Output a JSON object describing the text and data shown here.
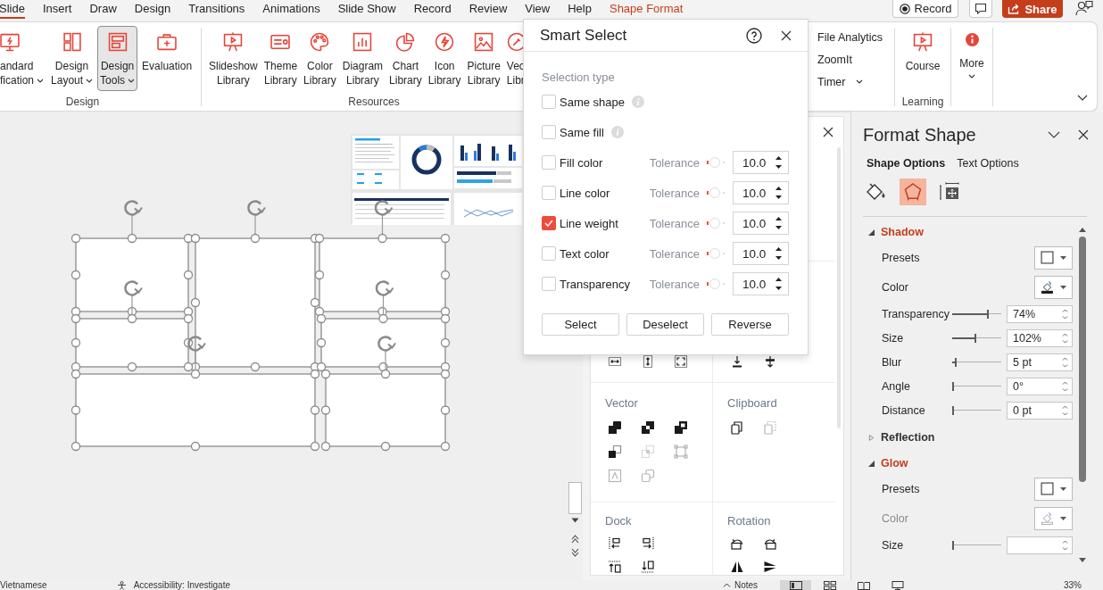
{
  "tabs": [
    {
      "label": "Slide",
      "selected": true,
      "contextual": false
    },
    {
      "label": "Insert",
      "selected": false,
      "contextual": false
    },
    {
      "label": "Draw",
      "selected": false,
      "contextual": false
    },
    {
      "label": "Design",
      "selected": false,
      "contextual": false
    },
    {
      "label": "Transitions",
      "selected": false,
      "contextual": false
    },
    {
      "label": "Animations",
      "selected": false,
      "contextual": false
    },
    {
      "label": "Slide Show",
      "selected": false,
      "contextual": false
    },
    {
      "label": "Record",
      "selected": false,
      "contextual": false
    },
    {
      "label": "Review",
      "selected": false,
      "contextual": false
    },
    {
      "label": "View",
      "selected": false,
      "contextual": false
    },
    {
      "label": "Help",
      "selected": false,
      "contextual": false
    },
    {
      "label": "Shape Format",
      "selected": false,
      "contextual": true
    }
  ],
  "title_actions": {
    "record": "Record",
    "share": "Share"
  },
  "ribbon": {
    "groups": [
      {
        "kind": "large",
        "label": "Design",
        "buttons": [
          {
            "kind": "monitor",
            "lines": [
              "andard",
              "fication"
            ],
            "dropdown": true,
            "pressed": false
          },
          {
            "kind": "layout",
            "lines": [
              "Design",
              "Layout"
            ],
            "dropdown": true,
            "pressed": false
          },
          {
            "kind": "tools",
            "lines": [
              "Design",
              "Tools"
            ],
            "dropdown": true,
            "pressed": true
          },
          {
            "kind": "kit",
            "lines": [
              "Evaluation"
            ],
            "dropdown": false,
            "pressed": false
          }
        ]
      },
      {
        "kind": "large",
        "label": "Resources",
        "buttons": [
          {
            "kind": "easel",
            "lines": [
              "Slideshow",
              "Library"
            ],
            "dropdown": false,
            "pressed": false
          },
          {
            "kind": "theme",
            "lines": [
              "Theme",
              "Library"
            ],
            "dropdown": false,
            "pressed": false
          },
          {
            "kind": "palette",
            "lines": [
              "Color",
              "Library"
            ],
            "dropdown": false,
            "pressed": false
          },
          {
            "kind": "diagram",
            "lines": [
              "Diagram",
              "Library"
            ],
            "dropdown": false,
            "pressed": false
          },
          {
            "kind": "pie",
            "lines": [
              "Chart",
              "Library"
            ],
            "dropdown": false,
            "pressed": false
          },
          {
            "kind": "bolt",
            "lines": [
              "Icon",
              "Library"
            ],
            "dropdown": false,
            "pressed": false
          },
          {
            "kind": "picture",
            "lines": [
              "Picture",
              "Library"
            ],
            "dropdown": false,
            "pressed": false
          },
          {
            "kind": "pen",
            "lines": [
              "Vec",
              "Libr"
            ],
            "dropdown": false,
            "pressed": false
          }
        ]
      },
      {
        "kind": "small",
        "buttons": [
          {
            "label": "File Analytics",
            "dropdown": false
          },
          {
            "label": "ZoomIt",
            "dropdown": false
          },
          {
            "label": "Timer",
            "dropdown": true
          }
        ]
      },
      {
        "kind": "large",
        "label": "Learning",
        "buttons": [
          {
            "kind": "easel",
            "lines": [
              "Course"
            ],
            "dropdown": false,
            "pressed": false
          }
        ]
      },
      {
        "kind": "large",
        "buttons": [
          {
            "kind": "info",
            "lines": [
              "More"
            ],
            "dropdown": true,
            "pressed": false
          }
        ]
      }
    ]
  },
  "canvas": {
    "shapes": [
      {
        "selected": true
      },
      {
        "selected": true
      },
      {
        "selected": true
      },
      {
        "selected": true
      },
      {
        "selected": true
      },
      {
        "selected": true
      },
      {
        "selected": true
      }
    ]
  },
  "tools_panel": {
    "sections": [
      {
        "columns": [
          {
            "rows": [
              [
                {
                  "kind": "same-width",
                  "disabled": false
                },
                {
                  "kind": "same-height",
                  "disabled": false
                },
                {
                  "kind": "same-size",
                  "disabled": false
                }
              ]
            ]
          },
          {
            "rows": [
              [
                {
                  "kind": "align-bottom",
                  "disabled": false
                },
                {
                  "kind": "distribute",
                  "disabled": false
                }
              ]
            ]
          }
        ]
      },
      {
        "columns": [
          {
            "title": "Vector",
            "rows": [
              [
                {
                  "kind": "union",
                  "disabled": false
                },
                {
                  "kind": "combine",
                  "disabled": false
                },
                {
                  "kind": "intersect",
                  "disabled": false
                }
              ],
              [
                {
                  "kind": "subtract",
                  "disabled": false
                },
                {
                  "kind": "fragment",
                  "disabled": true
                },
                {
                  "kind": "edit-points",
                  "disabled": true
                }
              ],
              [
                {
                  "kind": "text-box",
                  "disabled": true
                },
                {
                  "kind": "duplicate",
                  "disabled": true
                }
              ]
            ]
          },
          {
            "title": "Clipboard",
            "rows": [
              [
                {
                  "kind": "copy",
                  "disabled": false
                },
                {
                  "kind": "paste",
                  "disabled": true
                }
              ]
            ]
          }
        ]
      },
      {
        "columns": [
          {
            "title": "Dock",
            "rows": [
              [
                {
                  "kind": "dock-left",
                  "disabled": false
                },
                {
                  "kind": "dock-right",
                  "disabled": false
                }
              ],
              [
                {
                  "kind": "dock-top",
                  "disabled": false
                },
                {
                  "kind": "dock-bottom",
                  "disabled": false
                }
              ]
            ]
          },
          {
            "title": "Rotation",
            "rows": [
              [
                {
                  "kind": "rotate-left",
                  "disabled": false
                },
                {
                  "kind": "rotate-right",
                  "disabled": false
                }
              ],
              [
                {
                  "kind": "flip-horizontal",
                  "disabled": false
                },
                {
                  "kind": "flip-vertical",
                  "disabled": false
                }
              ]
            ]
          }
        ]
      }
    ]
  },
  "smart_select": {
    "title": "Smart Select",
    "section_label": "Selection type",
    "options": [
      {
        "kind": "info",
        "label": "Same shape",
        "checked": false
      },
      {
        "kind": "info",
        "label": "Same fill",
        "checked": false
      },
      {
        "kind": "tolerance",
        "label": "Fill color",
        "checked": false,
        "tolerance_label": "Tolerance",
        "level": 0.1,
        "value": "10.0"
      },
      {
        "kind": "tolerance",
        "label": "Line color",
        "checked": false,
        "tolerance_label": "Tolerance",
        "level": 0.1,
        "value": "10.0"
      },
      {
        "kind": "tolerance",
        "label": "Line weight",
        "checked": true,
        "tolerance_label": "Tolerance",
        "level": 0.1,
        "value": "10.0"
      },
      {
        "kind": "tolerance",
        "label": "Text color",
        "checked": false,
        "tolerance_label": "Tolerance",
        "level": 0.1,
        "value": "10.0"
      },
      {
        "kind": "tolerance",
        "label": "Transparency",
        "checked": false,
        "tolerance_label": "Tolerance",
        "level": 0.1,
        "value": "10.0"
      }
    ],
    "buttons": [
      "Select",
      "Deselect",
      "Reverse"
    ]
  },
  "format_panel": {
    "title": "Format Shape",
    "tabs": [
      {
        "label": "Shape Options",
        "selected": true
      },
      {
        "label": "Text Options",
        "selected": false
      }
    ],
    "icon_tabs": [
      {
        "kind": "fill",
        "selected": false
      },
      {
        "kind": "effects",
        "selected": true
      },
      {
        "kind": "size",
        "selected": false
      }
    ],
    "sections": [
      {
        "title": "Shadow",
        "expanded": true,
        "rows": [
          {
            "kind": "preset",
            "label": "Presets",
            "disabled": false
          },
          {
            "kind": "color",
            "label": "Color",
            "disabled": false
          },
          {
            "kind": "slider",
            "label": "Transparency",
            "level": 0.74,
            "value": "74%",
            "disabled": false
          },
          {
            "kind": "slider",
            "label": "Size",
            "level": 0.47,
            "value": "102%",
            "disabled": false
          },
          {
            "kind": "slider",
            "label": "Blur",
            "level": 0.05,
            "value": "5 pt",
            "disabled": false
          },
          {
            "kind": "slider",
            "label": "Angle",
            "level": 0,
            "value": "0°",
            "disabled": false
          },
          {
            "kind": "slider",
            "label": "Distance",
            "level": 0,
            "value": "0 pt",
            "disabled": false
          }
        ]
      },
      {
        "title": "Reflection",
        "expanded": false
      },
      {
        "title": "Glow",
        "expanded": true,
        "rows": [
          {
            "kind": "preset",
            "label": "Presets",
            "disabled": false
          },
          {
            "kind": "color",
            "label": "Color",
            "disabled": true
          },
          {
            "kind": "slider",
            "label": "Size",
            "level": 0,
            "disabled": false
          }
        ]
      }
    ]
  },
  "status_bar": {
    "language": "Vietnamese",
    "accessibility": "Accessibility: Investigate",
    "notes": "Notes",
    "views": [
      {
        "kind": "normal",
        "selected": true
      },
      {
        "kind": "sorter",
        "selected": false
      },
      {
        "kind": "reading",
        "selected": false
      },
      {
        "kind": "slideshow",
        "selected": false
      }
    ],
    "zoom": "33%"
  }
}
